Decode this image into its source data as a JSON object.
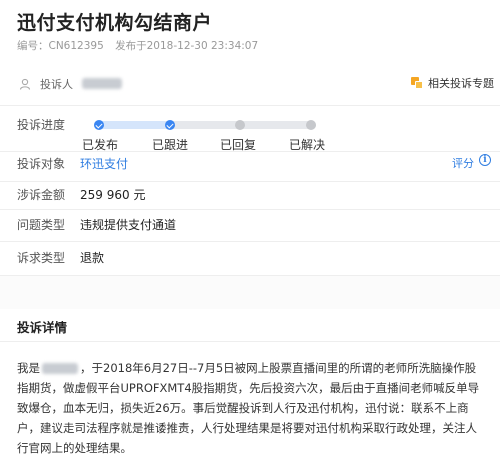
{
  "header": {
    "title": "迅付支付机构勾结商户",
    "id_label": "编号：",
    "id_value": "CN612395",
    "published_label": "发布于",
    "published_value": "2018-12-30 23:34:07"
  },
  "complainant": {
    "label": "投诉人",
    "avatar_icon": "user-icon",
    "related_icon": "topic-icon",
    "related_label": "相关投诉专题"
  },
  "progress": {
    "label": "投诉进度",
    "steps": [
      {
        "label": "已发布",
        "done": true
      },
      {
        "label": "已跟进",
        "done": true
      },
      {
        "label": "已回复",
        "done": false
      },
      {
        "label": "已解决",
        "done": false
      }
    ],
    "completed_fraction": 0.33,
    "colors": {
      "done": "#3a86f2",
      "todo": "#c6c8cc",
      "track_fill": "#d5e5fb",
      "track": "#e6e8ec"
    }
  },
  "fields": {
    "target_label": "投诉对象",
    "target_value": "环迅支付",
    "rating_label": "评分",
    "info_icon": "info-icon",
    "amount_label": "涉诉金额",
    "amount_value": "259 960 元",
    "issue_label": "问题类型",
    "issue_value": "违规提供支付通道",
    "demand_label": "诉求类型",
    "demand_value": "退款"
  },
  "detail": {
    "title": "投诉详情",
    "prefix": "我是",
    "body": "，于2018年6月27日--7月5日被网上股票直播间里的所谓的老师所洗脑操作股指期货，做虚假平台UPROFXMT4股指期货，先后投资六次，最后由于直播间老师喊反单导致爆仓，血本无归，损失近26万。事后觉醒投诉到人行及迅付机构，迅付说：联系不上商户，建议走司法程序就是推诿推责，人行处理结果是将要对迅付机构采取行政处理，关注人行官网上的处理结果。"
  },
  "accent_color": "#2f7de1"
}
